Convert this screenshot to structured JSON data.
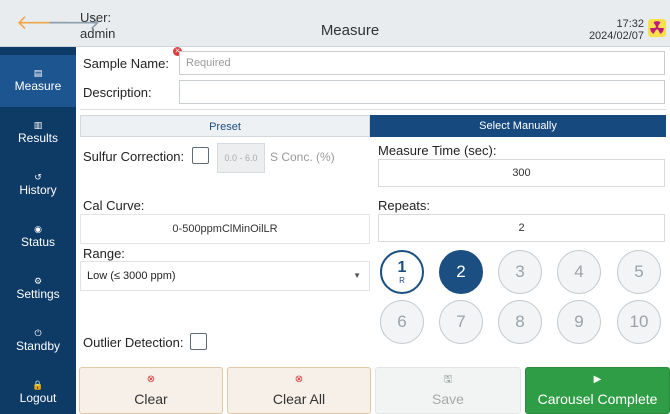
{
  "header": {
    "back_arrow": "🡐",
    "forward_arrow": "🡒",
    "user_label": "User:",
    "user_name": "admin",
    "title": "Measure",
    "time": "17:32",
    "date": "2024/02/07",
    "radiation_icon": "radiation-icon"
  },
  "sidebar": {
    "items": [
      {
        "label": "Measure",
        "icon": "▤",
        "active": true
      },
      {
        "label": "Results",
        "icon": "▥"
      },
      {
        "label": "History",
        "icon": "↺"
      },
      {
        "label": "Status",
        "icon": "◉"
      },
      {
        "label": "Settings",
        "icon": "⚙"
      },
      {
        "label": "Standby",
        "icon": "⏻"
      },
      {
        "label": "Logout",
        "icon": "🔒"
      }
    ]
  },
  "form": {
    "sample_name_label": "Sample Name:",
    "sample_name_placeholder": "Required",
    "sample_name_value": "",
    "description_label": "Description:",
    "description_value": "",
    "preset_tab": "Preset",
    "manual_tab": "Select Manually",
    "sulfur_label": "Sulfur Correction:",
    "sulfur_range": "0.0 - 6.0",
    "sulfur_unit": "S Conc. (%)",
    "cal_curve_label": "Cal Curve:",
    "cal_curve_value": "0-500ppmClMinOilLR",
    "range_label": "Range:",
    "range_value": "Low (≤ 3000 ppm)",
    "outlier_label": "Outlier Detection:",
    "measure_time_label": "Measure Time (sec):",
    "measure_time_value": "300",
    "repeats_label": "Repeats:",
    "repeats_value": "2"
  },
  "positions": {
    "current": "1",
    "current_sub": "R",
    "items": [
      "1",
      "2",
      "3",
      "4",
      "5",
      "6",
      "7",
      "8",
      "9",
      "10"
    ],
    "selected": "2"
  },
  "buttons": {
    "clear": "Clear",
    "clear_all": "Clear All",
    "save": "Save",
    "carousel": "Carousel Complete"
  },
  "colors": {
    "sidebar_bg": "#0e3a66",
    "sidebar_active": "#1d5590",
    "accent_blue": "#1b4f82",
    "carousel_green": "#2f9d46",
    "error_red": "#d9322e"
  }
}
